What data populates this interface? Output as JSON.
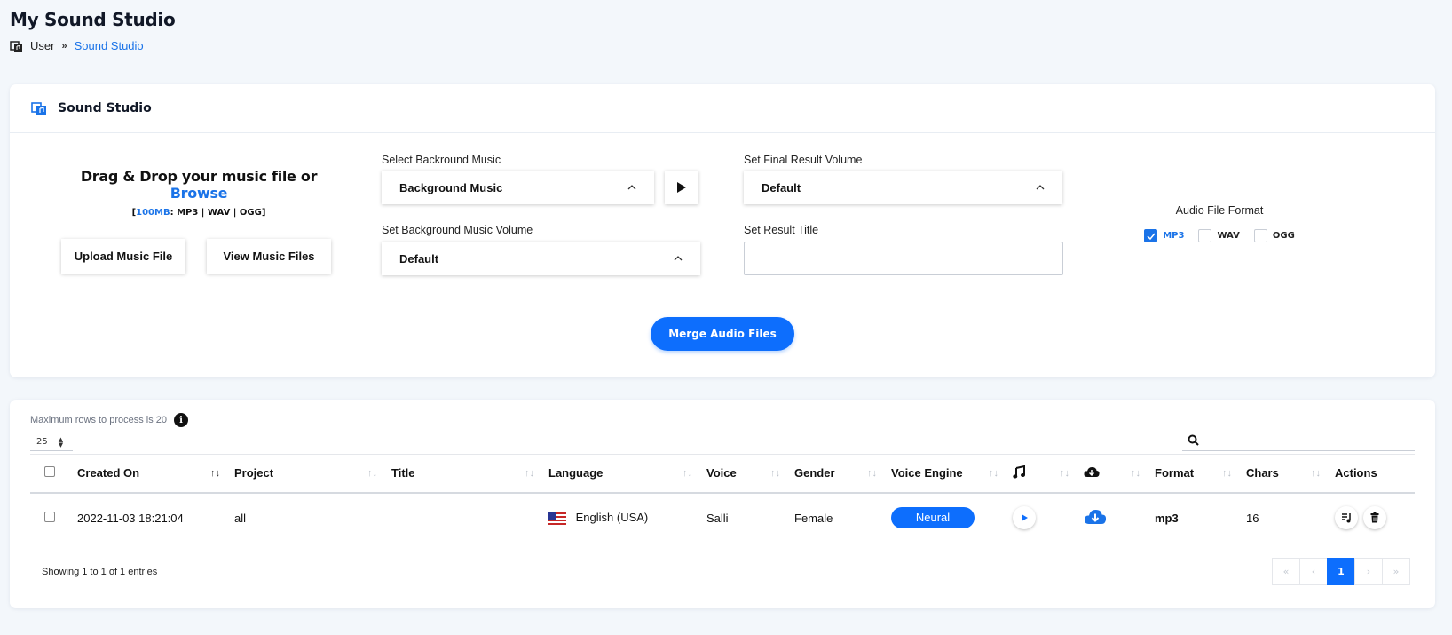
{
  "page": {
    "title": "My Sound Studio"
  },
  "breadcrumb": {
    "home": "User",
    "current": "Sound Studio"
  },
  "studio": {
    "card_title": "Sound Studio",
    "dropzone": {
      "title_prefix": "Drag & Drop your music file or",
      "browse": "Browse",
      "limit": "100MB",
      "formats": ": MP3 | WAV | OGG"
    },
    "upload_button": "Upload Music File",
    "view_button": "View Music Files",
    "bg_music_label": "Select Backround Music",
    "bg_music_value": "Background Music",
    "bg_volume_label": "Set Background Music Volume",
    "bg_volume_value": "Default",
    "final_volume_label": "Set Final Result Volume",
    "final_volume_value": "Default",
    "result_title_label": "Set Result Title",
    "result_title_value": "",
    "format_title": "Audio File Format",
    "formats": [
      {
        "label": "MP3",
        "checked": true
      },
      {
        "label": "WAV",
        "checked": false
      },
      {
        "label": "OGG",
        "checked": false
      }
    ],
    "merge_button": "Merge Audio Files"
  },
  "table_controls": {
    "max_rows": "Maximum rows to process is 20",
    "page_length": "25",
    "search_value": ""
  },
  "table": {
    "columns": [
      "Created On",
      "Project",
      "Title",
      "Language",
      "Voice",
      "Gender",
      "Voice Engine",
      "",
      "",
      "Format",
      "Chars",
      "Actions"
    ],
    "rows": [
      {
        "created_on": "2022-11-03 18:21:04",
        "project": "all",
        "title": "",
        "language": "English (USA)",
        "voice": "Salli",
        "gender": "Female",
        "engine": "Neural",
        "format": "mp3",
        "chars": "16"
      }
    ]
  },
  "footer": {
    "showing": "Showing 1 to 1 of 1 entries",
    "current_page": "1"
  },
  "colors": {
    "accent": "#0d6efd",
    "link": "#1a73e8"
  }
}
